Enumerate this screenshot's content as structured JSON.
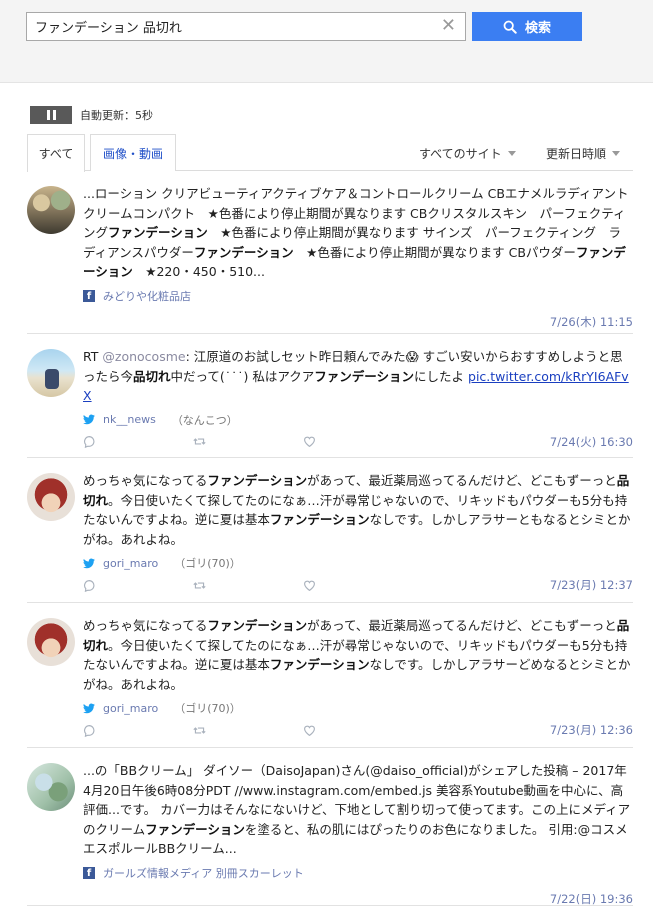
{
  "search": {
    "query": "ファンデーション 品切れ",
    "button_label": "検索"
  },
  "autoupdate": {
    "label": "自動更新：5秒"
  },
  "tabs": [
    {
      "label": "すべて",
      "active": true
    },
    {
      "label": "画像・動画",
      "active": false
    }
  ],
  "filters": {
    "site": "すべてのサイト",
    "sort": "更新日時順"
  },
  "items": [
    {
      "source_type": "facebook",
      "segments": [
        {
          "t": "...ローション クリアビューティアクティブケア＆コントロールクリーム CBエナメルラディアントクリームコンパクト　★色番により停止期間が異なります CBクリスタルスキン　パーフェクティング"
        },
        {
          "t": "ファンデーション",
          "b": true
        },
        {
          "t": "　★色番により停止期間が異なります サインズ　パーフェクティング　ラディアンスパウダー"
        },
        {
          "t": "ファンデーション",
          "b": true
        },
        {
          "t": "　★色番により停止期間が異なります CBパウダー"
        },
        {
          "t": "ファンデーション",
          "b": true
        },
        {
          "t": "　★220・450・510..."
        }
      ],
      "source": "みどりや化粧品店",
      "nick": "",
      "time": "7/26(木) 11:15"
    },
    {
      "source_type": "twitter",
      "segments": [
        {
          "t": "RT "
        },
        {
          "t": "@zonocosme",
          "m": true
        },
        {
          "t": ": 江原道のお試しセット昨日頼んでみた😱 すごい安いからおすすめしようと思ったら今"
        },
        {
          "t": "品切れ",
          "b": true
        },
        {
          "t": "中だって(˙˙˙) 私はアクア"
        },
        {
          "t": "ファンデーション",
          "b": true
        },
        {
          "t": "にしたよ "
        },
        {
          "t": "pic.twitter.com/kRrYI6AFvX",
          "l": true
        }
      ],
      "source": "nk__news",
      "nick": "（なんこつ）",
      "time": "7/24(火) 16:30"
    },
    {
      "source_type": "twitter",
      "segments": [
        {
          "t": "めっちゃ気になってる"
        },
        {
          "t": "ファンデーション",
          "b": true
        },
        {
          "t": "があって、最近薬局巡ってるんだけど、どこもずーっと"
        },
        {
          "t": "品切れ",
          "b": true
        },
        {
          "t": "。今日使いたくて探してたのになぁ…汗が尋常じゃないので、リキッドもパウダーも5分も持たないんですよね。逆に夏は基本"
        },
        {
          "t": "ファンデーション",
          "b": true
        },
        {
          "t": "なしです。しかしアラサーともなるとシミとかがね。あれよね。"
        }
      ],
      "source": "gori_maro",
      "nick": "（ゴリ(70)）",
      "time": "7/23(月) 12:37"
    },
    {
      "source_type": "twitter",
      "segments": [
        {
          "t": "めっちゃ気になってる"
        },
        {
          "t": "ファンデーション",
          "b": true
        },
        {
          "t": "があって、最近薬局巡ってるんだけど、どこもずーっと"
        },
        {
          "t": "品切れ",
          "b": true
        },
        {
          "t": "。今日使いたくて探してたのになぁ…汗が尋常じゃないので、リキッドもパウダーも5分も持たないんですよね。逆に夏は基本"
        },
        {
          "t": "ファンデーション",
          "b": true
        },
        {
          "t": "なしです。しかしアラサーどめなるとシミとかがね。あれよね。"
        }
      ],
      "source": "gori_maro",
      "nick": "（ゴリ(70)）",
      "time": "7/23(月) 12:36"
    },
    {
      "source_type": "facebook",
      "segments": [
        {
          "t": "...の「BBクリーム」 ダイソー（DaisoJapan)さん(@daiso_official)がシェアした投稿 – 2017年 4月20日午後6時08分PDT //www.instagram.com/embed.js 美容系Youtube動画を中心に、高評価...です。 カバー力はそんなにないけど、下地として割り切って使ってます。この上にメディアのクリーム"
        },
        {
          "t": "ファンデーション",
          "b": true
        },
        {
          "t": "を塗ると、私の肌にはぴったりのお色になりました。 引用:@コスメ エスポルールBBクリーム..."
        }
      ],
      "source": "ガールズ情報メディア 別冊スカーレット",
      "nick": "",
      "time": "7/22(日) 19:36"
    }
  ],
  "colors": {
    "accent": "#3b7ef2",
    "link": "#1a3fc0",
    "meta": "#6a7ab0",
    "facebook": "#3b5998",
    "twitter": "#1da1f2"
  }
}
